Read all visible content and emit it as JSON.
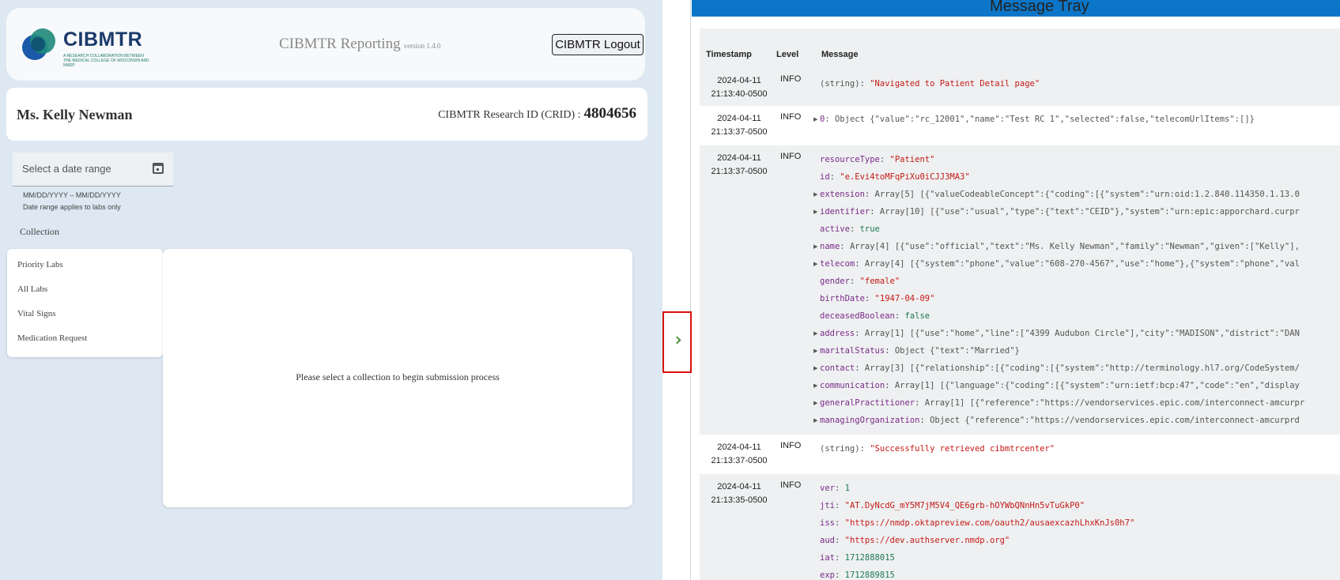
{
  "app": {
    "logo_text": "CIBMTR",
    "logo_subtitle": "A research collaboration between the Medical College of Wisconsin and NMDP",
    "title": "CIBMTR Reporting",
    "version": "version 1.4.0",
    "logout_label": "CIBMTR Logout"
  },
  "patient": {
    "name": "Ms. Kelly Newman",
    "crid_label": "CIBMTR Research ID (CRID) :",
    "crid_value": "4804656"
  },
  "date_range": {
    "placeholder": "Select a date range",
    "format_hint": "MM/DD/YYYY – MM/DD/YYYY",
    "note": "Date range applies to labs only"
  },
  "collection": {
    "label": "Collection",
    "items": [
      {
        "label": "Priority Labs"
      },
      {
        "label": "All Labs"
      },
      {
        "label": "Vital Signs"
      },
      {
        "label": "Medication Request"
      }
    ],
    "empty_message": "Please select a collection to begin submission process"
  },
  "tray": {
    "title": "Message Tray",
    "columns": [
      "Timestamp",
      "Level",
      "Message"
    ],
    "rows": [
      {
        "date": "2024-04-11",
        "time": "21:13:40-0500",
        "level": "INFO",
        "lines": [
          "(string): \"Navigated to Patient Detail page\""
        ]
      },
      {
        "date": "2024-04-11",
        "time": "21:13:37-0500",
        "level": "INFO",
        "lines": [
          "0: Object {\"value\":\"rc_12001\",\"name\":\"Test RC 1\",\"selected\":false,\"telecomUrlItems\":[]}"
        ]
      },
      {
        "date": "2024-04-11",
        "time": "21:13:37-0500",
        "level": "INFO",
        "lines": [
          "resourceType: \"Patient\"",
          "id: \"e.Evi4toMFqPiXu0iCJJ3MA3\"",
          "extension: Array[5] [{\"valueCodeableConcept\":{\"coding\":[{\"system\":\"urn:oid:1.2.840.114350.1.13.0",
          "identifier: Array[10] [{\"use\":\"usual\",\"type\":{\"text\":\"CEID\"},\"system\":\"urn:epic:apporchard.curpr",
          "active: true",
          "name: Array[4] [{\"use\":\"official\",\"text\":\"Ms. Kelly Newman\",\"family\":\"Newman\",\"given\":[\"Kelly\"],",
          "telecom: Array[4] [{\"system\":\"phone\",\"value\":\"608-270-4567\",\"use\":\"home\"},{\"system\":\"phone\",\"val",
          "gender: \"female\"",
          "birthDate: \"1947-04-09\"",
          "deceasedBoolean: false",
          "address: Array[1] [{\"use\":\"home\",\"line\":[\"4399 Audubon Circle\"],\"city\":\"MADISON\",\"district\":\"DAN",
          "maritalStatus: Object {\"text\":\"Married\"}",
          "contact: Array[3] [{\"relationship\":[{\"coding\":[{\"system\":\"http://terminology.hl7.org/CodeSystem/",
          "communication: Array[1] [{\"language\":{\"coding\":[{\"system\":\"urn:ietf:bcp:47\",\"code\":\"en\",\"display",
          "generalPractitioner: Array[1] [{\"reference\":\"https://vendorservices.epic.com/interconnect-amcurpr",
          "managingOrganization: Object {\"reference\":\"https://vendorservices.epic.com/interconnect-amcurprd"
        ]
      },
      {
        "date": "2024-04-11",
        "time": "21:13:37-0500",
        "level": "INFO",
        "lines": [
          "(string): \"Successfully retrieved cibmtrcenter\""
        ]
      },
      {
        "date": "2024-04-11",
        "time": "21:13:35-0500",
        "level": "INFO",
        "lines": [
          "ver: 1",
          "jti: \"AT.DyNcdG_mY5M7jM5V4_QE6grb-hOYWbQNnHn5vTuGkP0\"",
          "iss: \"https://nmdp.oktapreview.com/oauth2/ausaexcazhLhxKnJs0h7\"",
          "aud: \"https://dev.authserver.nmdp.org\"",
          "iat: 1712888015",
          "exp: 1712889815"
        ]
      }
    ]
  },
  "colors": {
    "page_bg": "#dde8f2",
    "tray_header": "#0b76c8",
    "toggle_border": "#d9100f",
    "string_value": "#c41a16",
    "number_value": "#1c7a52",
    "key": "#7a2a8a"
  },
  "icons": {
    "calendar": "calendar-icon",
    "expand": "chevron-right-icon",
    "disclosure": "triangle-right-icon"
  }
}
